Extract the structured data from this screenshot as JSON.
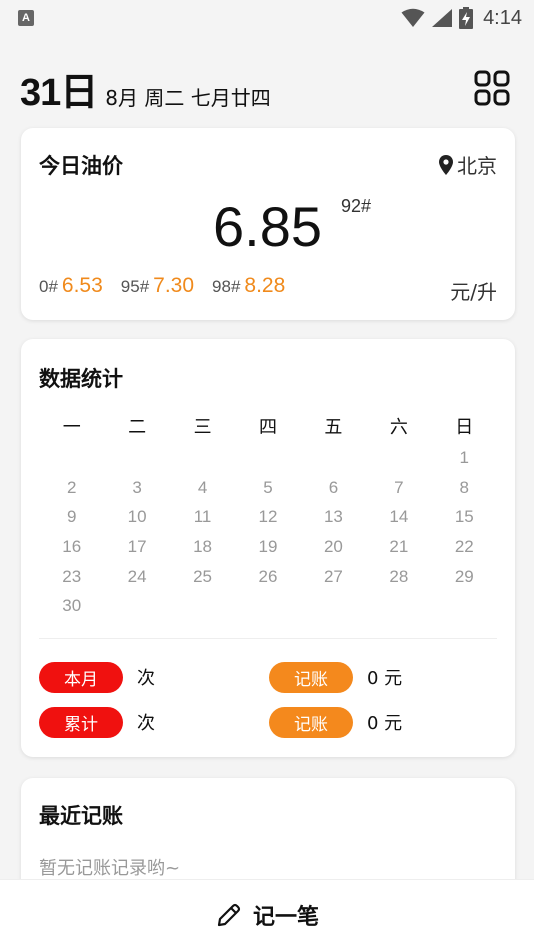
{
  "status_bar": {
    "app_notification": "A",
    "time": "4:14"
  },
  "header": {
    "day": "31日",
    "date_detail": "8月 周二 七月廿四"
  },
  "oil_price": {
    "title": "今日油价",
    "location": "北京",
    "main_price": "6.85",
    "main_grade": "92#",
    "others": [
      {
        "grade": "0#",
        "price": "6.53"
      },
      {
        "grade": "95#",
        "price": "7.30"
      },
      {
        "grade": "98#",
        "price": "8.28"
      }
    ],
    "unit": "元/升",
    "accent_color": "#f08a1c"
  },
  "stats": {
    "title": "数据统计",
    "weekdays": [
      "一",
      "二",
      "三",
      "四",
      "五",
      "六",
      "日"
    ],
    "weeks": [
      [
        "",
        "",
        "",
        "",
        "",
        "",
        "1"
      ],
      [
        "2",
        "3",
        "4",
        "5",
        "6",
        "7",
        "8"
      ],
      [
        "9",
        "10",
        "11",
        "12",
        "13",
        "14",
        "15"
      ],
      [
        "16",
        "17",
        "18",
        "19",
        "20",
        "21",
        "22"
      ],
      [
        "23",
        "24",
        "25",
        "26",
        "27",
        "28",
        "29"
      ],
      [
        "30",
        "",
        "",
        "",
        "",
        "",
        ""
      ]
    ],
    "month_label": "本月",
    "month_count": "次",
    "month_record_label": "记账",
    "month_amount": "0 元",
    "total_label": "累计",
    "total_count": "次",
    "total_record_label": "记账",
    "total_amount": "0 元"
  },
  "recent": {
    "title": "最近记账",
    "empty_text": "暂无记账记录哟~"
  },
  "bottom": {
    "add_label": "记一笔"
  }
}
